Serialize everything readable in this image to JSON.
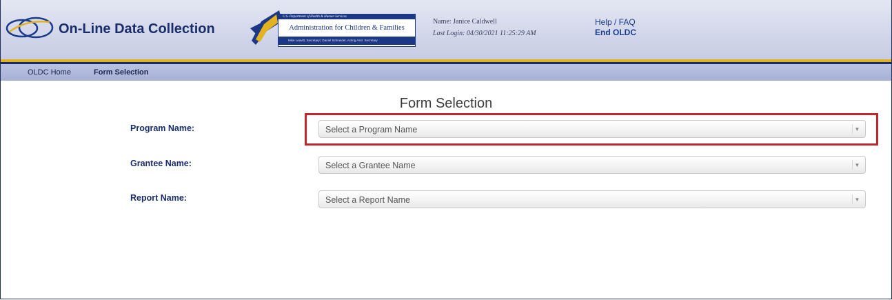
{
  "app": {
    "title": "On-Line Data Collection"
  },
  "agency": {
    "dept_line": "U.S. Department of Health & Human Services",
    "name": "Administration for Children & Families",
    "officials_line": "Mike Leavitt, Secretary | Daniel Schneider, Acting Asst. Secretary"
  },
  "user": {
    "name_line": "Name: Janice Caldwell",
    "last_login_line": "Last Login: 04/30/2021 11:25:29 AM"
  },
  "links": {
    "help": "Help / FAQ",
    "end": "End OLDC"
  },
  "nav": {
    "home": "OLDC Home",
    "current": "Form Selection"
  },
  "page": {
    "title": "Form Selection",
    "fields": {
      "program": {
        "label": "Program Name:",
        "placeholder": "Select a Program Name"
      },
      "grantee": {
        "label": "Grantee Name:",
        "placeholder": "Select a Grantee Name"
      },
      "report": {
        "label": "Report Name:",
        "placeholder": "Select a Report Name"
      }
    }
  },
  "colors": {
    "brand_navy": "#1a2d6b",
    "accent_gold": "#e4b21f",
    "highlight_red": "#c0262e"
  },
  "icons": [
    "oldc-logo-ovals-icon",
    "hhs-eagle-seal-icon",
    "chevron-down-icon"
  ]
}
